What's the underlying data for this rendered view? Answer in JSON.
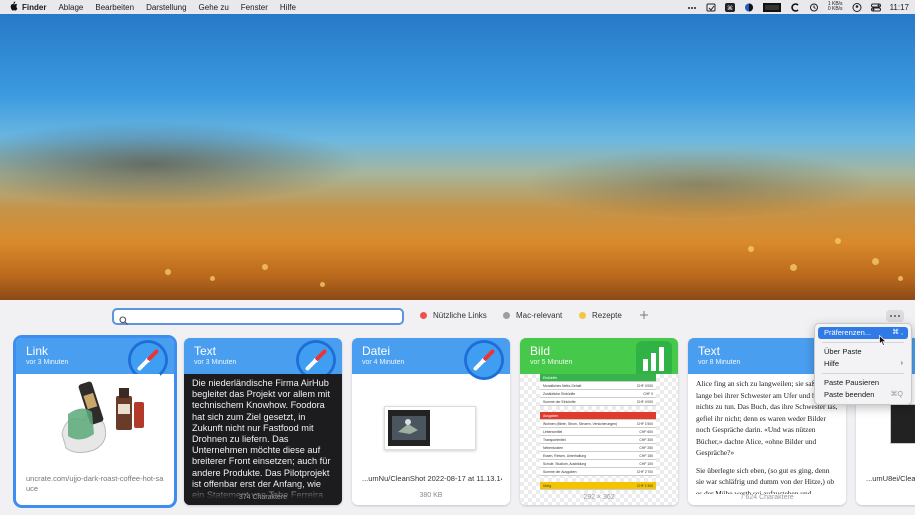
{
  "menubar": {
    "app": "Finder",
    "items": [
      "Ablage",
      "Bearbeiten",
      "Darstellung",
      "Gehe zu",
      "Fenster",
      "Hilfe"
    ],
    "net_up": "1 KB/s",
    "net_down": "0 KB/s",
    "time": "11:17"
  },
  "search": {
    "placeholder": "",
    "value": ""
  },
  "pinboards": [
    {
      "label": "Nützliche Links",
      "color": "#ef5350"
    },
    {
      "label": "Mac-relevant",
      "color": "#9e9e9e"
    },
    {
      "label": "Rezepte",
      "color": "#f5c542"
    }
  ],
  "cards": {
    "link": {
      "type": "Link",
      "time": "vor 3 Minuten",
      "color": "#4a9ef0",
      "url": "uncrate.com/ujjo-dark-roast-coffee-hot-sauce"
    },
    "text1": {
      "type": "Text",
      "time": "vor 3 Minuten",
      "color": "#4a9ef0",
      "content": "Die niederländische Firma AirHub begleitet das Projekt vor allem mit technischem Knowhow. Foodora hat sich zum Ziel gesetzt, in Zukunft nicht nur Fastfood mit Drohnen zu liefern. Das Unternehmen möchte diese auf breiterer Front einsetzen; auch für andere Produkte. Das Pilotprojekt ist offenbar erst der Anfang, wie ein Statement von Tobe Ferreira",
      "count": "374 Charaktere"
    },
    "file": {
      "type": "Datei",
      "time": "vor 4 Minuten",
      "color": "#4a9ef0",
      "name": "...umNu/CleanShot 2022-08-17 at 11.13.14",
      "size": "380 KB"
    },
    "image": {
      "type": "Bild",
      "time": "vor 5 Minuten",
      "color": "#46c84a",
      "dimensions": "292 × 362",
      "rows": [
        {
          "label": "Einkünfte",
          "value": "",
          "style": "g"
        },
        {
          "label": "Monatliches Netto-Gehalt",
          "value": "CHF 4'000",
          "style": ""
        },
        {
          "label": "Zusätzliche Einkünfte",
          "value": "CHF 0",
          "style": ""
        },
        {
          "label": "Summe der Einkünfte",
          "value": "CHF 4'000",
          "style": ""
        },
        {
          "label": "",
          "value": "",
          "style": "gap"
        },
        {
          "label": "Ausgaben",
          "value": "",
          "style": "rd"
        },
        {
          "label": "Wohnen (Miete, Strom, Steuern, Versicherungen)",
          "value": "CHF 1'500",
          "style": ""
        },
        {
          "label": "Lebensmittel",
          "value": "CHF 600",
          "style": ""
        },
        {
          "label": "Transportmittel",
          "value": "CHF 300",
          "style": ""
        },
        {
          "label": "Nebenkosten",
          "value": "CHF 250",
          "style": ""
        },
        {
          "label": "Essen, Reisen, Unterhaltung",
          "value": "CHF 150",
          "style": ""
        },
        {
          "label": "Schule, Studium, Ausbildung",
          "value": "CHF 100",
          "style": ""
        },
        {
          "label": "Summe der Ausgaben",
          "value": "CHF 2'700",
          "style": ""
        },
        {
          "label": "",
          "value": "",
          "style": "gap"
        },
        {
          "label": "Übrig",
          "value": "CHF 1'300",
          "style": "y"
        }
      ]
    },
    "text2": {
      "type": "Text",
      "time": "vor 8 Minuten",
      "color": "#4a9ef0",
      "p1": "Alice fing an sich zu langweilen; sie saß schon lange bei ihrer Schwester am Ufer und hatte nichts zu tun. Das Buch, das ihre Schwester las, gefiel ihr nicht; denn es waren weder Bilder noch Gespräche darin. «Und was nützen Bücher,» dachte Alice, «ohne Bilder und Gespräche?»",
      "p2": "Sie überlegte sich eben, (so gut es ging, denn sie war schläfrig und dumm von der Hitze,) ob es der Mühe werth sei aufzustehen und",
      "count": "7'624 Charaktere"
    },
    "partial": {
      "name": "...umU8ei/Clean"
    }
  },
  "context_menu": {
    "items": [
      {
        "label": "Präferenzen...",
        "shortcut": "⌘ ,",
        "highlighted": true
      },
      {
        "label": "Über Paste",
        "shortcut": ""
      },
      {
        "label": "Hilfe",
        "shortcut": "›"
      },
      {
        "label": "Paste Pausieren",
        "shortcut": ""
      },
      {
        "label": "Paste beenden",
        "shortcut": "⌘Q"
      }
    ]
  }
}
